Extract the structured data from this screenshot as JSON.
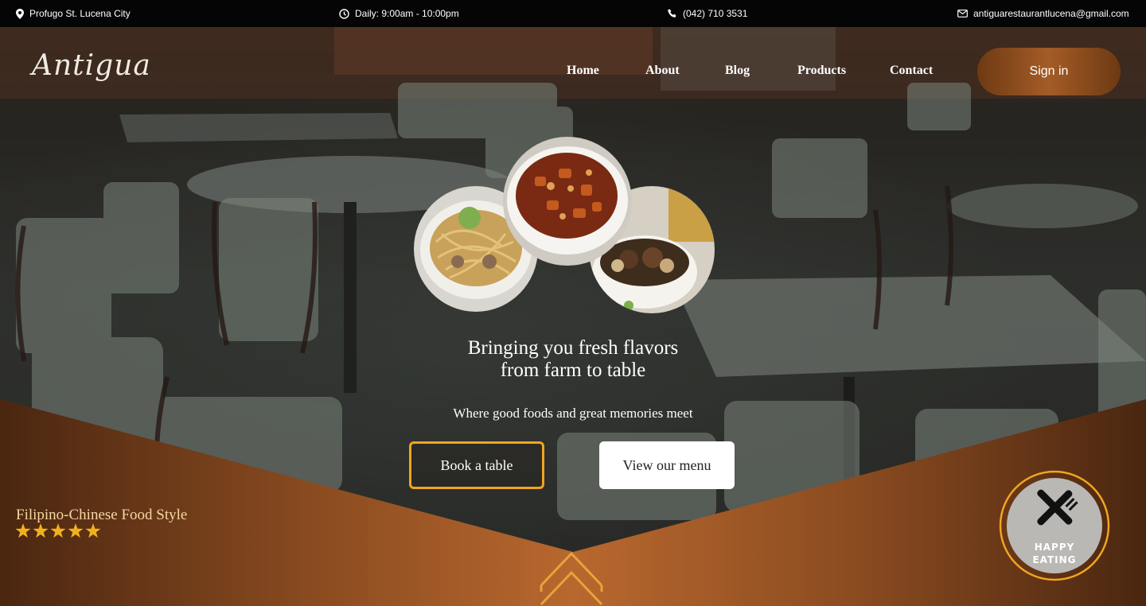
{
  "topbar": {
    "address": "Profugo St. Lucena City",
    "hours": "Daily: 9:00am - 10:00pm",
    "phone": "(042) 710 3531",
    "email": "antiguarestaurantlucena@gmail.com"
  },
  "brand": {
    "logo_text": "Antigua"
  },
  "nav": {
    "items": [
      "Home",
      "About",
      "Blog",
      "Products",
      "Contact"
    ],
    "sign_in": "Sign in"
  },
  "hero": {
    "headline_line1": "Bringing you fresh flavors",
    "headline_line2": "from farm to table",
    "subheadline": "Where good foods and great memories meet",
    "book_button": "Book a table",
    "menu_button": "View our menu",
    "tagline": "Filipino-Chinese Food Style",
    "rating_stars": 5
  },
  "badge": {
    "line1": "HAPPY",
    "line2": "EATING"
  },
  "colors": {
    "accent_orange": "#f0a51e",
    "brown": "#a45c27",
    "topbar_bg": "#050505"
  }
}
